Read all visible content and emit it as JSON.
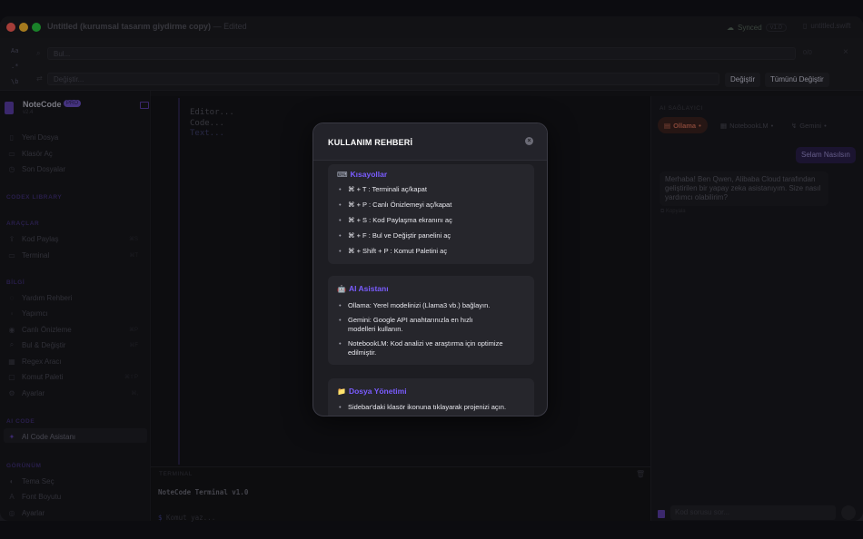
{
  "window": {
    "title": "Untitled (kurumsal tasarım giydirme copy)",
    "title_suffix": "— Edited",
    "sync_status": "Synced",
    "sync_pill": "v1.0",
    "filename": "untitled.swift",
    "traffic_colors": [
      "#fe5f57",
      "#febc2e",
      "#28c840"
    ]
  },
  "findbar": {
    "side_labels": [
      "Aa",
      ".*",
      "\\b"
    ],
    "find_placeholder": "Bul...",
    "replace_placeholder": "Değiştir...",
    "count": "0/0",
    "replace_label": "Değiştir",
    "replace_all_label": "Tümünü Değiştir"
  },
  "sidebar": {
    "brand": "NoteCode",
    "badge": "PRO",
    "brand_sub": "v2.4",
    "top_items": [
      {
        "icon": "doc-icon",
        "glyph": "▯",
        "label": "Yeni Dosya"
      },
      {
        "icon": "folder-icon",
        "glyph": "▭",
        "label": "Klasör Aç"
      },
      {
        "icon": "clock-icon",
        "glyph": "◷",
        "label": "Son Dosyalar"
      }
    ],
    "sections": {
      "library": "CODEX LIBRARY",
      "tools": "ARAÇLAR",
      "info": "BİLGİ",
      "ai": "AI CODE",
      "view": "GÖRÜNÜM"
    },
    "tools": [
      {
        "icon": "share-icon",
        "glyph": "⇪",
        "label": "Kod Paylaş",
        "key": "⌘S"
      },
      {
        "icon": "terminal-icon",
        "glyph": "▭",
        "label": "Terminal",
        "key": "⌘T"
      }
    ],
    "info": [
      {
        "icon": "help-icon",
        "glyph": "◌",
        "label": "Yardım Rehberi",
        "key": ""
      },
      {
        "icon": "user-icon",
        "glyph": "◦",
        "label": "Yapımcı",
        "key": ""
      },
      {
        "icon": "eye-icon",
        "glyph": "◉",
        "label": "Canlı Önizleme",
        "key": "⌘P"
      },
      {
        "icon": "search-icon",
        "glyph": "⌕",
        "label": "Bul & Değiştir",
        "key": "⌘F"
      },
      {
        "icon": "regex-icon",
        "glyph": "▦",
        "label": "Regex Aracı",
        "key": ""
      },
      {
        "icon": "palette-icon",
        "glyph": "▢",
        "label": "Komut Paleti",
        "key": "⌘⇧P"
      },
      {
        "icon": "gear-icon",
        "glyph": "⚙",
        "label": "Ayarlar",
        "key": "⌘,"
      }
    ],
    "ai": [
      {
        "icon": "sparkle-icon",
        "glyph": "✦",
        "label": "AI Code Asistanı"
      }
    ],
    "view": [
      {
        "icon": "theme-icon",
        "glyph": "◐",
        "label": "Tema Seç"
      },
      {
        "icon": "font-icon",
        "glyph": "A",
        "label": "Font Boyutu"
      },
      {
        "icon": "gear-icon",
        "glyph": "◎",
        "label": "Ayarlar"
      }
    ]
  },
  "editor": {
    "lines": [
      "Editor...",
      "Code...",
      "Text..."
    ]
  },
  "terminal": {
    "header": "TERMINAL",
    "version_line": "NoteCode Terminal v1.0",
    "prompt": "$",
    "input_placeholder": "Komut yaz..."
  },
  "ai_panel": {
    "header": "AI SAĞLAYICI",
    "tabs": [
      {
        "icon": "ollama-icon",
        "label": "Ollama",
        "status": "•"
      },
      {
        "icon": "notebook-icon",
        "label": "NotebookLM",
        "status": "•"
      },
      {
        "icon": "gemini-icon",
        "label": "Gemini",
        "status": "•"
      }
    ],
    "user_message": "Selam Nasılsın",
    "ai_message": "Merhaba! Ben Qwen, Alibaba Cloud tarafından geliştirilen bir yapay zeka asistanıyım. Size nasıl yardımcı olabilirim?",
    "copy_label": "Kopyala",
    "input_placeholder": "Kod sorusu sor..."
  },
  "modal": {
    "title": "KULLANIM REHBERİ",
    "sections": [
      {
        "emoji": "⌨",
        "title": "Kısayollar",
        "items": [
          "⌘ + T : Terminali aç/kapat",
          "⌘ + P : Canlı Önizlemeyi aç/kapat",
          "⌘ + S : Kod Paylaşma ekranını aç",
          "⌘ + F : Bul ve Değiştir panelini aç",
          "⌘ + Shift + P : Komut Paletini aç"
        ]
      },
      {
        "emoji": "🤖",
        "title": "AI Asistanı",
        "items": [
          "Ollama: Yerel modelinizi (Llama3 vb.) bağlayın.",
          "Gemini: Google API anahtarınızla en hızlı modelleri kullanın.",
          "NotebookLM: Kod analizi ve araştırma için optimize edilmiştir."
        ]
      },
      {
        "emoji": "📁",
        "title": "Dosya Yönetimi",
        "items": [
          "Sidebar'daki klasör ikonuna tıklayarak projenizi açın."
        ]
      }
    ]
  }
}
